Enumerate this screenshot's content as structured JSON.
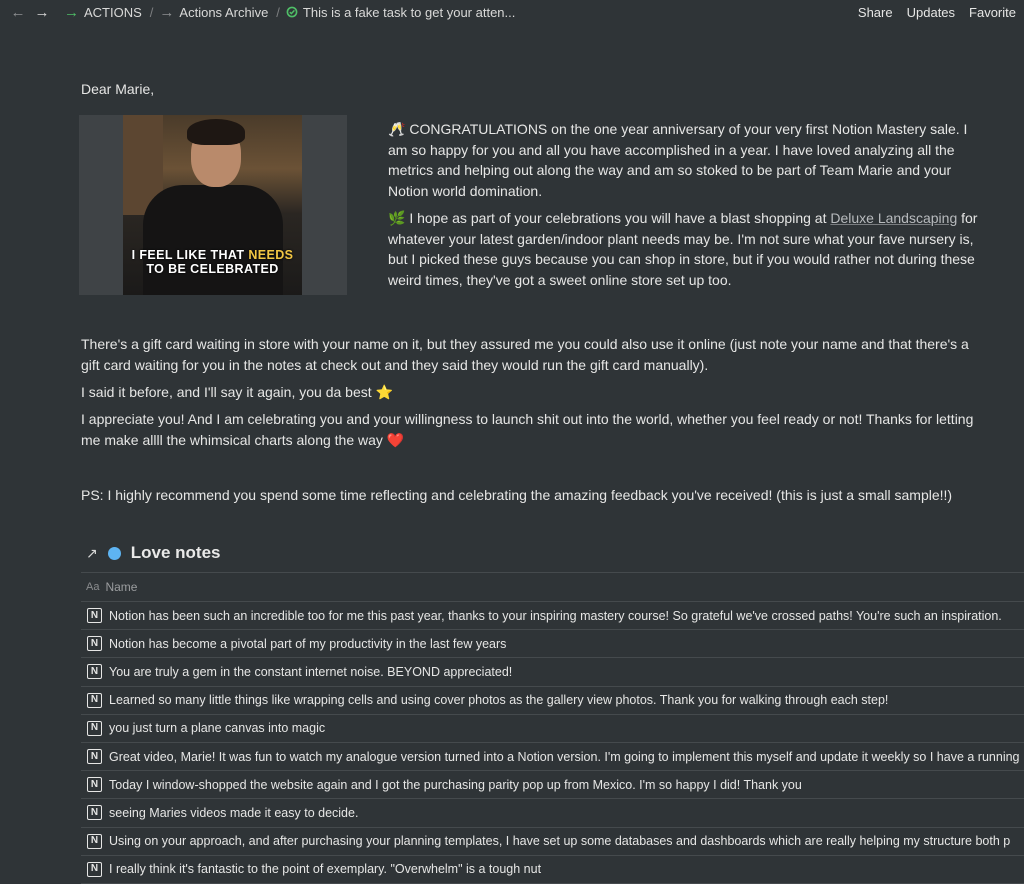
{
  "topbar": {
    "breadcrumbs": [
      {
        "label": "ACTIONS"
      },
      {
        "label": "Actions Archive"
      },
      {
        "label": "This is a fake task to get your atten..."
      }
    ],
    "actions": {
      "share": "Share",
      "updates": "Updates",
      "favorite": "Favorite"
    }
  },
  "letter": {
    "greeting": "Dear Marie,",
    "gif_caption_line1_a": "I FEEL LIKE THAT ",
    "gif_caption_line1_b": "NEEDS",
    "gif_caption_line2": "TO BE CELEBRATED",
    "p1_emoji": "🥂",
    "p1": " CONGRATULATIONS on the one year anniversary of your very first Notion Mastery sale. I am so happy for you and all you have accomplished in a year. I have loved analyzing all the metrics and helping out along the way and am so stoked to be part of Team Marie and your Notion world domination.",
    "p2_emoji": "🌿",
    "p2_before": " I hope as part of your celebrations you will have a blast shopping at ",
    "p2_link": "Deluxe Landscaping",
    "p2_after": " for whatever your latest garden/indoor plant needs may be. I'm not sure what your fave nursery is, but I picked these guys because you can shop in store, but if you would rather not during these weird times, they've got a sweet online store set up too.",
    "p3": "There's a gift card waiting in store with your name on it, but they assured me you could also use it online (just note your name and that there's a gift card waiting for you in the notes at check out and they said they would run the gift card manually).",
    "p4": "I said it before, and I'll say it again, you da best ⭐",
    "p5": "I appreciate you! And I am celebrating you and your willingness to launch shit out into the world, whether you feel ready or not! Thanks for letting me make allll the whimsical charts along the way ❤️",
    "p6": "PS: I highly recommend you spend some time reflecting and celebrating the amazing feedback you've received! (this is just a small sample!!)"
  },
  "database": {
    "title": "Love notes",
    "dot_color": "#5eb4f2",
    "column": "Name",
    "column_icon_text": "Aa",
    "row_icon": "N",
    "rows": [
      "Notion has been such an incredible too for me this past year, thanks to your inspiring mastery course! So grateful we've crossed paths! You're such an inspiration.",
      "Notion has become a pivotal part of my productivity in the last few years",
      "You are truly a gem in the constant internet noise. BEYOND appreciated!",
      "Learned so many little things like wrapping cells and using cover photos as the gallery view photos. Thank you for walking through each step!",
      "you just turn a plane canvas into magic",
      "Great video, Marie! It was fun to watch my analogue version turned into a Notion version. I'm going to implement this myself and update it weekly so I have a running",
      "Today I window-shopped the website again and I got the purchasing parity pop up from Mexico. I'm so happy I did! Thank you",
      "seeing Maries videos made it easy to decide.",
      "Using on your approach, and after purchasing your planning templates, I have set up some databases and dashboards which are really helping my structure both p",
      "I really think it's fantastic to the point of exemplary. \"Overwhelm\" is a tough nut"
    ]
  }
}
